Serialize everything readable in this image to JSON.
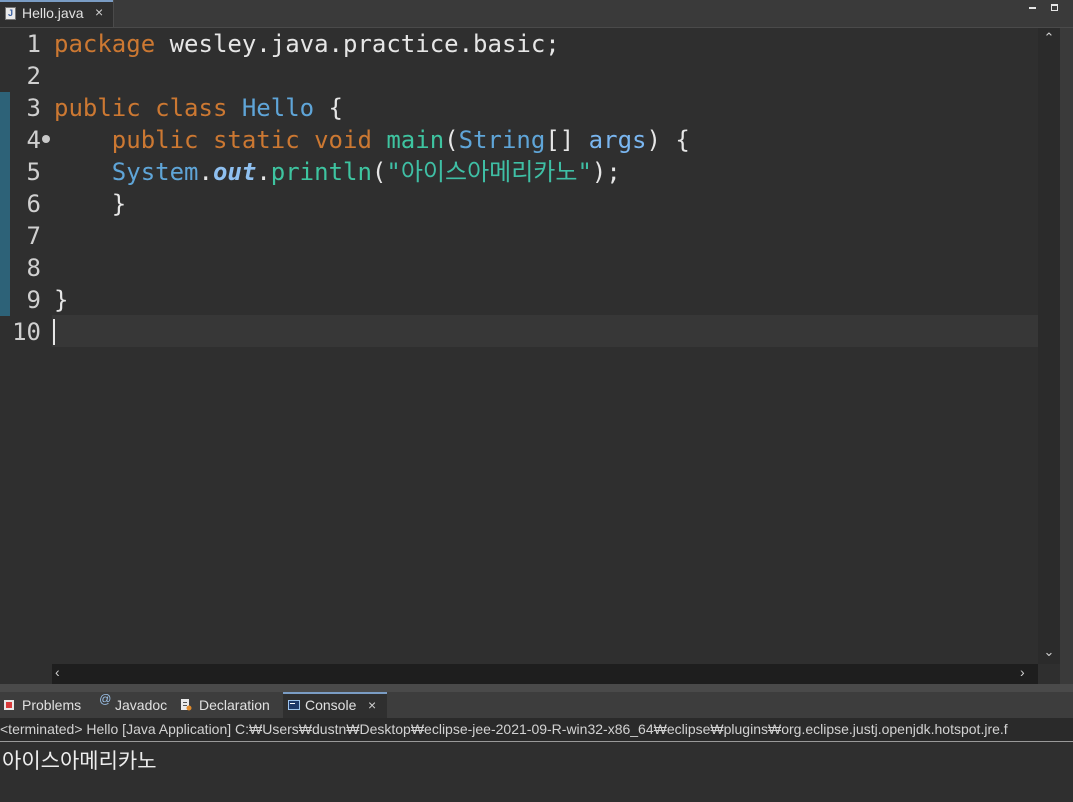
{
  "editor_tab": {
    "label": "Hello.java",
    "close": "×",
    "icon": "java-file-icon"
  },
  "window_controls": {
    "minimize": "minimize-icon",
    "maximize": "maximize-icon"
  },
  "editor": {
    "line_numbers": [
      "1",
      "2",
      "3",
      "4",
      "5",
      "6",
      "7",
      "8",
      "9",
      "10"
    ],
    "line1": {
      "kw": "package",
      "rest": " wesley.java.practice.basic;"
    },
    "line3": {
      "kw1": "public",
      "kw2": "class",
      "name": "Hello",
      "brace": " {"
    },
    "line4": {
      "kw1": "public",
      "kw2": "static",
      "kw3": "void",
      "fn": "main",
      "open": "(",
      "type": "String",
      "arr": "[] ",
      "param": "args",
      "close": ") {"
    },
    "line5": {
      "obj": "System",
      "dot1": ".",
      "field": "out",
      "dot2": ".",
      "fn": "println",
      "open": "(",
      "str": "\"아이스아메리카노\"",
      "close": ");"
    },
    "line6": "}",
    "line9": "}"
  },
  "scrollbars": {
    "up": "⌃",
    "down": "⌄",
    "left": "‹",
    "right": "›"
  },
  "panel": {
    "tabs": [
      {
        "label": "Problems",
        "icon": "problems-icon"
      },
      {
        "label": "Javadoc",
        "icon": "javadoc-icon"
      },
      {
        "label": "Declaration",
        "icon": "declaration-icon"
      },
      {
        "label": "Console",
        "icon": "console-icon",
        "close": "×"
      }
    ],
    "console_header": "<terminated> Hello [Java Application] C:₩Users₩dustn₩Desktop₩eclipse-jee-2021-09-R-win32-x86_64₩eclipse₩plugins₩org.eclipse.justj.openjdk.hotspot.jre.f",
    "console_output": "아이스아메리카노"
  },
  "colors": {
    "keyword": "#cc7832",
    "type": "#5fa5d8",
    "method": "#3ec4a0",
    "string": "#3fbfa5",
    "background": "#2f2f2f"
  }
}
